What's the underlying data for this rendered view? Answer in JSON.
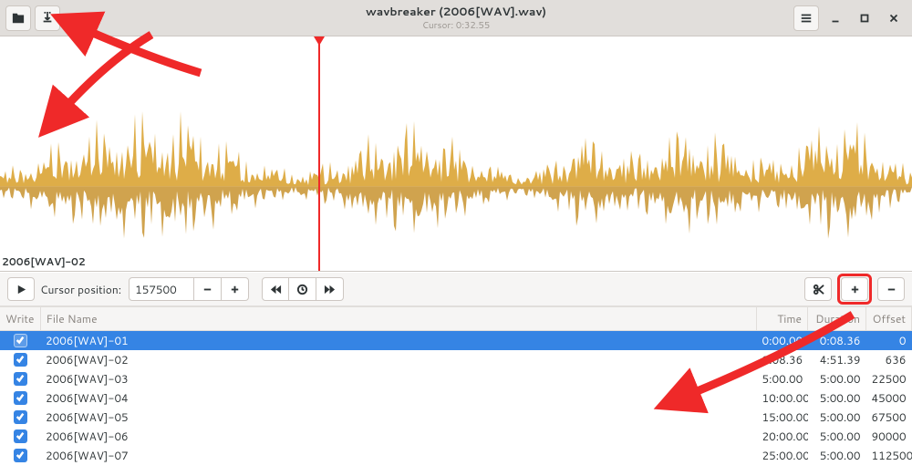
{
  "header": {
    "title": "wavbreaker (2006[WAV].wav)",
    "subtitle": "Cursor: 0:32.55"
  },
  "waveform": {
    "label": "2006[WAV]-02"
  },
  "toolbar": {
    "cursor_label": "Cursor position:",
    "cursor_value": "157500"
  },
  "table": {
    "headers": {
      "write": "Write",
      "filename": "File Name",
      "time": "Time",
      "duration": "Duration",
      "offset": "Offset"
    },
    "rows": [
      {
        "write": true,
        "filename": "2006[WAV]-01",
        "time": "0:00.00",
        "duration": "0:08.36",
        "offset": "0",
        "selected": true
      },
      {
        "write": true,
        "filename": "2006[WAV]-02",
        "time": "0:08.36",
        "duration": "4:51.39",
        "offset": "636"
      },
      {
        "write": true,
        "filename": "2006[WAV]-03",
        "time": "5:00.00",
        "duration": "5:00.00",
        "offset": "22500"
      },
      {
        "write": true,
        "filename": "2006[WAV]-04",
        "time": "10:00.00",
        "duration": "5:00.00",
        "offset": "45000"
      },
      {
        "write": true,
        "filename": "2006[WAV]-05",
        "time": "15:00.00",
        "duration": "5:00.00",
        "offset": "67500"
      },
      {
        "write": true,
        "filename": "2006[WAV]-06",
        "time": "20:00.00",
        "duration": "5:00.00",
        "offset": "90000"
      },
      {
        "write": true,
        "filename": "2006[WAV]-07",
        "time": "25:00.00",
        "duration": "5:00.00",
        "offset": "112500"
      }
    ]
  }
}
